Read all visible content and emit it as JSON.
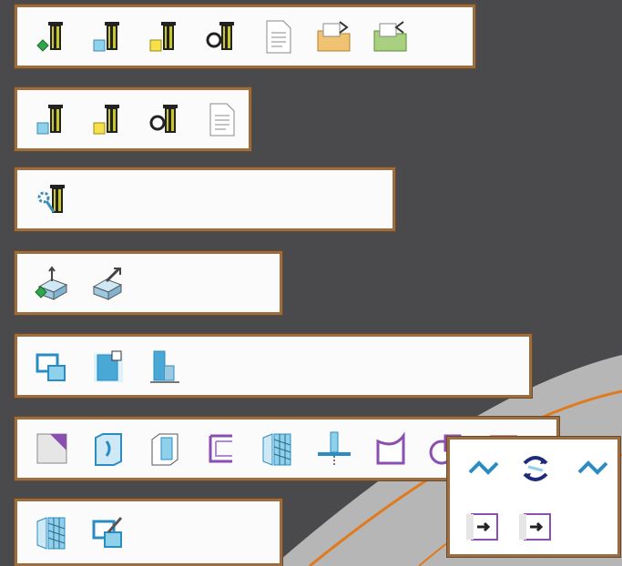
{
  "toolbars": [
    {
      "name": "tool-management",
      "icons": [
        "new-tool-icon",
        "edit-tool-icon",
        "copy-tool-icon",
        "find-tool-icon",
        "tool-report-icon",
        "export-tool-icon",
        "import-tool-icon"
      ]
    },
    {
      "name": "tool-library",
      "icons": [
        "edit-tool-icon",
        "copy-tool-icon",
        "find-tool-icon",
        "tool-report-icon"
      ]
    },
    {
      "name": "tool-settings",
      "icons": [
        "tool-settings-icon"
      ]
    },
    {
      "name": "stock-setup",
      "icons": [
        "stock-setup-icon",
        "stock-edit-icon"
      ]
    },
    {
      "name": "feature-types",
      "icons": [
        "face-feature-icon",
        "pocket-feature-icon",
        "step-feature-icon"
      ]
    },
    {
      "name": "machining-features",
      "icons": [
        "chamfer-icon",
        "slot-icon",
        "boss-icon",
        "profile-icon",
        "surface-mesh-icon",
        "drill-axis-icon",
        "contour-icon",
        "circle-feature-icon",
        "more-feature-icon"
      ]
    },
    {
      "name": "mesh-tools",
      "icons": [
        "mesh-surface-icon",
        "edit-surface-icon"
      ]
    }
  ],
  "flyout": {
    "icons": [
      "check-icon",
      "regenerate-icon",
      "check-alt-icon",
      "forward-icon",
      "forward-alt-icon"
    ]
  }
}
